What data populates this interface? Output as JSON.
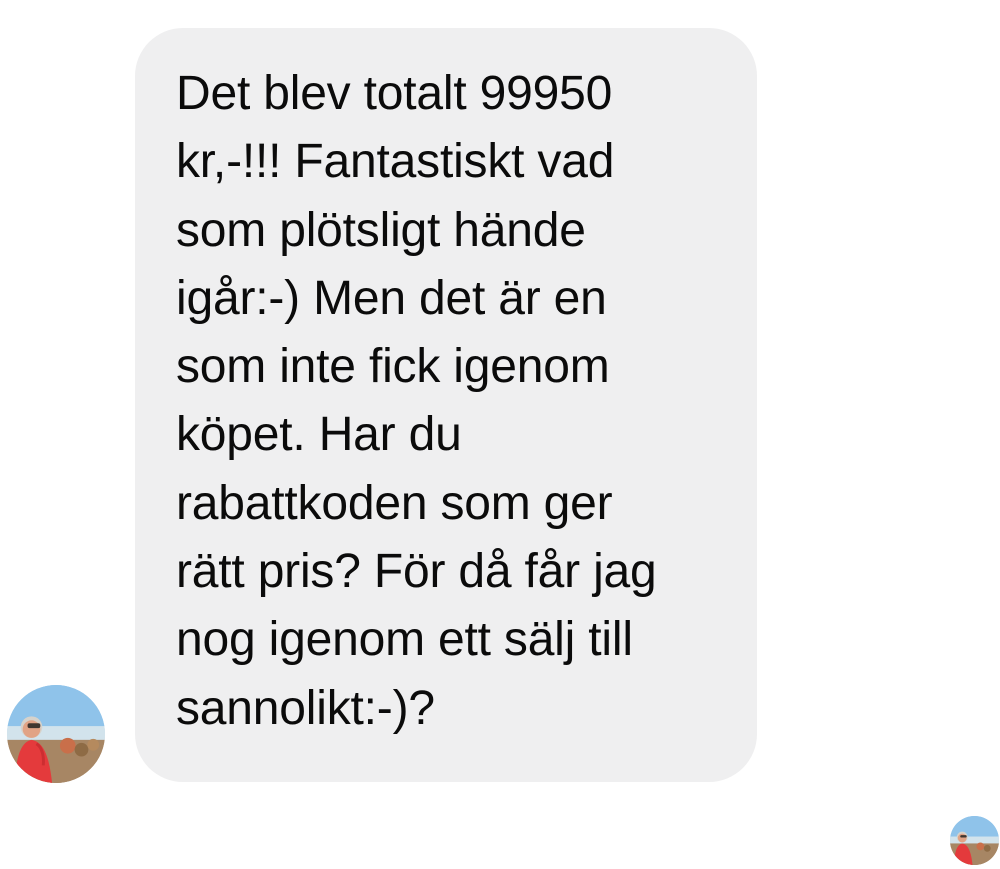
{
  "conversation": {
    "messages": [
      {
        "direction": "incoming",
        "lines": [
          "Det blev totalt 99950",
          "kr,-!!! Fantastiskt vad",
          "som plötsligt hände",
          "igår:-) Men det är en",
          "som inte fick igenom",
          "köpet. Har du",
          "rabattkoden som ger",
          "rätt pris? För då får jag",
          "nog igenom ett sälj till",
          "sannolikt:-)?"
        ]
      }
    ]
  },
  "colors": {
    "page_background": "#ffffff",
    "bubble_background": "#efeff0",
    "message_text": "#0b0b0b"
  },
  "icons": {
    "sender_avatar": "user-photo-avatar",
    "read_receipt_avatar": "user-photo-avatar"
  }
}
